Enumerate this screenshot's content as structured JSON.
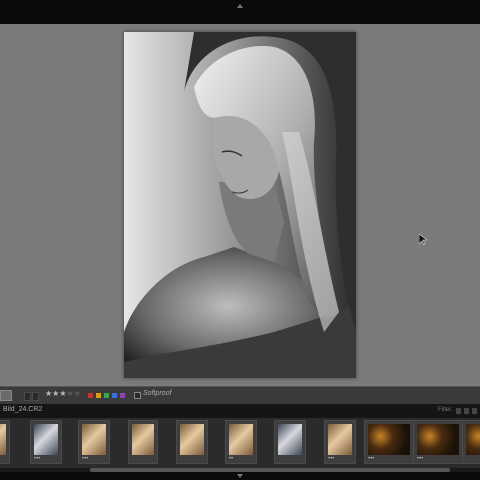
{
  "toolbar": {
    "rating": {
      "value": 3,
      "max": 5
    },
    "color_labels": [
      "#c0392b",
      "#d4a017",
      "#3fa34d",
      "#3a6fd8",
      "#8e44ad"
    ],
    "softproof_label": "Softproof",
    "icons": [
      "grid-view-icon",
      "collapse-up-icon",
      "collapse-down-icon",
      "cursor-icon"
    ]
  },
  "filmstrip": {
    "filename": "Bild_24.CR2",
    "filter_label": "Filter :",
    "thumbnails": [
      {
        "tone": "warm",
        "dots": "",
        "selected": false
      },
      {
        "tone": "cool",
        "dots": "•••",
        "selected": false
      },
      {
        "tone": "warm",
        "dots": "•••",
        "selected": false
      },
      {
        "tone": "warm",
        "dots": "",
        "selected": false
      },
      {
        "tone": "warm",
        "dots": "",
        "selected": false
      },
      {
        "tone": "warm",
        "dots": "••",
        "selected": false
      },
      {
        "tone": "cool",
        "dots": "",
        "selected": false
      },
      {
        "tone": "warm",
        "dots": "•••",
        "selected": false
      },
      {
        "tone": "dark",
        "dots": "•••",
        "selected": false
      },
      {
        "tone": "dark",
        "dots": "•••",
        "selected": false
      },
      {
        "tone": "dark",
        "dots": "",
        "selected": false
      }
    ]
  }
}
